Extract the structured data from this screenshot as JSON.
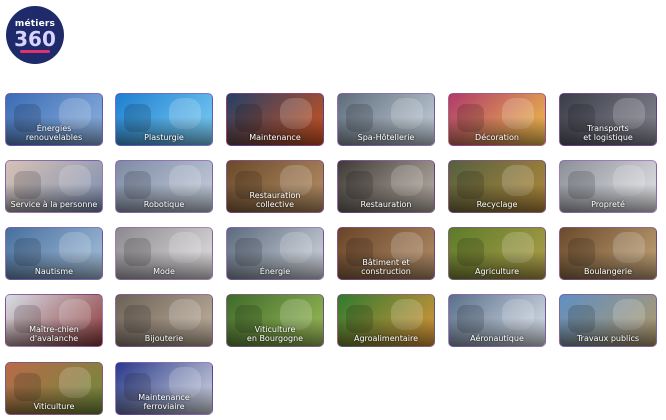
{
  "logo": {
    "line1": "métiers",
    "line2": "360"
  },
  "tiles": [
    {
      "label": "Énergies\nrenouvelables",
      "colors": [
        "#3a6bb5",
        "#8fb4e0"
      ]
    },
    {
      "label": "Plasturgie",
      "colors": [
        "#1e7fd0",
        "#7fd0f5"
      ]
    },
    {
      "label": "Maintenance",
      "colors": [
        "#243f66",
        "#d4541e"
      ]
    },
    {
      "label": "Spa-Hôtellerie",
      "colors": [
        "#5e6c7a",
        "#c9d4df"
      ]
    },
    {
      "label": "Décoration",
      "colors": [
        "#b03a6b",
        "#f1c34a"
      ]
    },
    {
      "label": "Transports\net logistique",
      "colors": [
        "#3a3c48",
        "#8a8a96"
      ]
    },
    {
      "label": "Service à la personne",
      "colors": [
        "#d7c2b4",
        "#7d8fb3"
      ]
    },
    {
      "label": "Robotique",
      "colors": [
        "#7d8aa3",
        "#c7d0de"
      ]
    },
    {
      "label": "Restauration\ncollective",
      "colors": [
        "#6b4a2a",
        "#b79067"
      ]
    },
    {
      "label": "Restauration",
      "colors": [
        "#3f3a37",
        "#bfb5aa"
      ]
    },
    {
      "label": "Recyclage",
      "colors": [
        "#556040",
        "#b38a3a"
      ]
    },
    {
      "label": "Propreté",
      "colors": [
        "#8b8f98",
        "#e7e7ea"
      ]
    },
    {
      "label": "Nautisme",
      "colors": [
        "#476f9e",
        "#a9c3dd"
      ]
    },
    {
      "label": "Mode",
      "colors": [
        "#8c8a8f",
        "#e5e1e3"
      ]
    },
    {
      "label": "Énergie",
      "colors": [
        "#5c6a7e",
        "#d6dbe2"
      ]
    },
    {
      "label": "Bâtiment et\nconstruction",
      "colors": [
        "#6a4428",
        "#b4906a"
      ]
    },
    {
      "label": "Agriculture",
      "colors": [
        "#5b7b2a",
        "#b3a04a"
      ]
    },
    {
      "label": "Boulangerie",
      "colors": [
        "#6a4a2a",
        "#c5a67c"
      ]
    },
    {
      "label": "Maître-chien d'avalanche",
      "colors": [
        "#d7dde6",
        "#8d3a3a"
      ]
    },
    {
      "label": "Bijouterie",
      "colors": [
        "#6b6157",
        "#c4b4a0"
      ]
    },
    {
      "label": "Viticulture\nen Bourgogne",
      "colors": [
        "#3e6a2a",
        "#9fbf5a"
      ]
    },
    {
      "label": "Agroalimentaire",
      "colors": [
        "#2f7a2f",
        "#e0973a"
      ]
    },
    {
      "label": "Aéronautique",
      "colors": [
        "#5a6f8a",
        "#dfe6ee"
      ]
    },
    {
      "label": "Travaux publics",
      "colors": [
        "#5f8fc2",
        "#b39a6a"
      ]
    },
    {
      "label": "Viticulture",
      "colors": [
        "#b86a4a",
        "#6f8a3a"
      ]
    },
    {
      "label": "Maintenance ferroviaire",
      "colors": [
        "#2a3a8a",
        "#d7dbe3"
      ]
    }
  ]
}
